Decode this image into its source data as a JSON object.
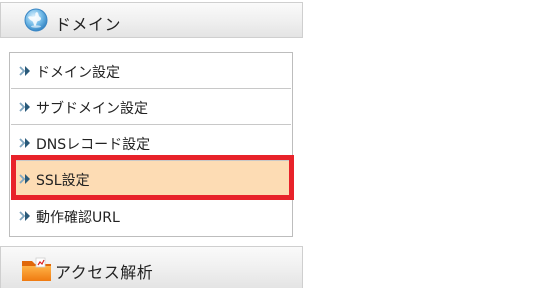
{
  "sections": [
    {
      "title": "ドメイン",
      "icon": "globe-icon",
      "items": [
        {
          "label": "ドメイン設定",
          "selected": false
        },
        {
          "label": "サブドメイン設定",
          "selected": false
        },
        {
          "label": "DNSレコード設定",
          "selected": false
        },
        {
          "label": "SSL設定",
          "selected": true
        },
        {
          "label": "動作確認URL",
          "selected": false
        }
      ]
    },
    {
      "title": "アクセス解析",
      "icon": "folder-icon"
    }
  ],
  "colors": {
    "selected_background": "#fddcb4",
    "highlight_border": "#e8222a",
    "arrow": "#2a5a7a"
  },
  "menu_item_icon": "double-chevron-right-icon"
}
